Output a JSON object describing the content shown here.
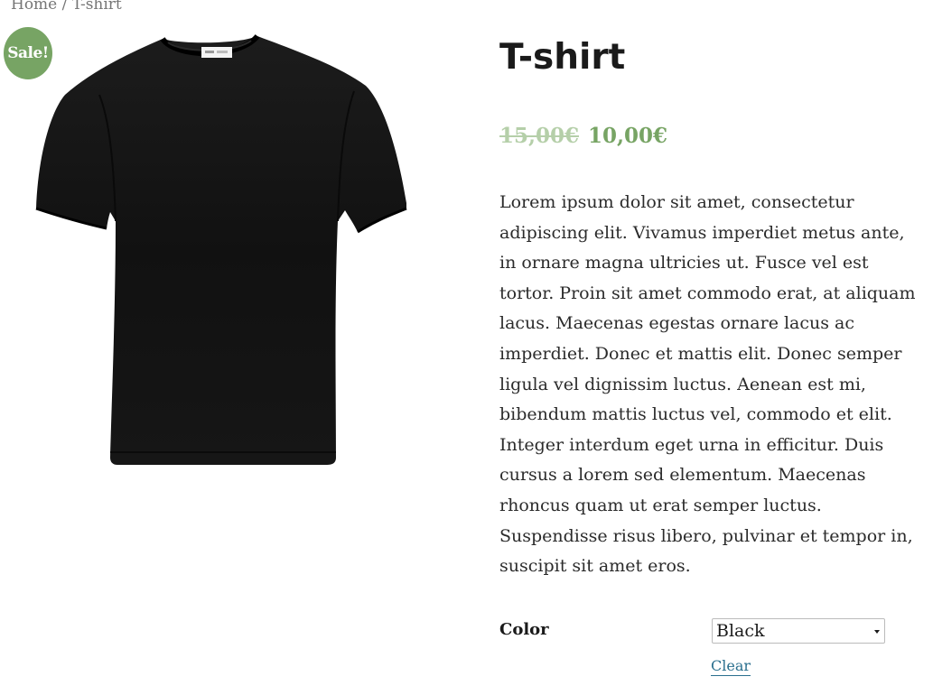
{
  "breadcrumb": {
    "home": "Home",
    "separator": " / ",
    "current": "T-shirt"
  },
  "gallery": {
    "sale_badge": "Sale!",
    "image_icon": "black-tshirt-image"
  },
  "product": {
    "title": "T-shirt",
    "price_regular": "15,00€",
    "price_sale": "10,00€",
    "description": "Lorem ipsum dolor sit amet, consectetur adipiscing elit. Vivamus imperdiet metus ante, in ornare magna ultricies ut. Fusce vel est tortor. Proin sit amet commodo erat, at aliquam lacus. Maecenas egestas ornare lacus ac imperdiet. Donec et mattis elit. Donec semper ligula vel dignissim luctus. Aenean est mi, bibendum mattis luctus vel, commodo et elit. Integer interdum eget urna in efficitur. Duis cursus a lorem sed elementum. Maecenas rhoncus quam ut erat semper luctus. Suspendisse risus libero, pulvinar et tempor in, suscipit sit amet eros."
  },
  "variations": {
    "color_label": "Color",
    "color_selected": "Black",
    "clear_label": "Clear"
  },
  "colors": {
    "sale": "#77a464",
    "price_old": "#b5cfa9",
    "link": "#2a6f8e"
  }
}
